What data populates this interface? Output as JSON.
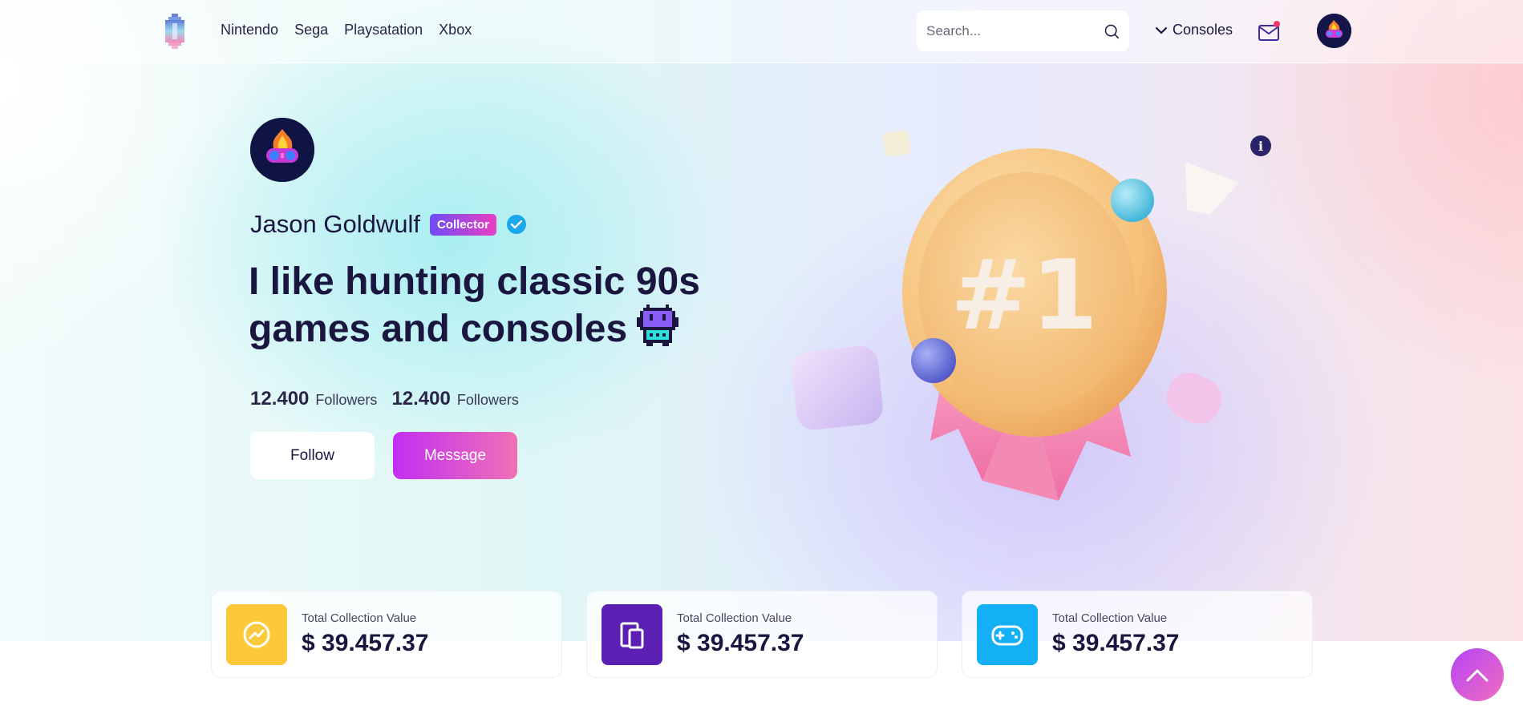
{
  "nav": {
    "links": [
      "Nintendo",
      "Sega",
      "Playsatation",
      "Xbox"
    ],
    "search_placeholder": "Search...",
    "consoles_label": "Consoles",
    "mail_has_notification": true
  },
  "profile": {
    "name": "Jason Goldwulf",
    "badge": "Collector",
    "verified": true,
    "headline": "I like hunting classic 90s games and consoles",
    "stats": [
      {
        "value": "12.400",
        "label": "Followers"
      },
      {
        "value": "12.400",
        "label": "Followers"
      }
    ],
    "follow_label": "Follow",
    "message_label": "Message"
  },
  "illustration": {
    "subject": "medal-number-one",
    "text": "#1"
  },
  "cards": [
    {
      "label": "Total Collection Value",
      "value": "$ 39.457.37",
      "icon": "trend-up-icon",
      "color": "#fcc93b"
    },
    {
      "label": "Total Collection Value",
      "value": "$ 39.457.37",
      "icon": "devices-icon",
      "color": "#5b1fb3"
    },
    {
      "label": "Total Collection Value",
      "value": "$ 39.457.37",
      "icon": "gamepad-icon",
      "color": "#13b0f5"
    }
  ],
  "colors": {
    "accent_purple": "#c22df2",
    "accent_pink": "#f071b5",
    "text_dark": "#1b1640",
    "verified_blue": "#1aa7ec"
  }
}
